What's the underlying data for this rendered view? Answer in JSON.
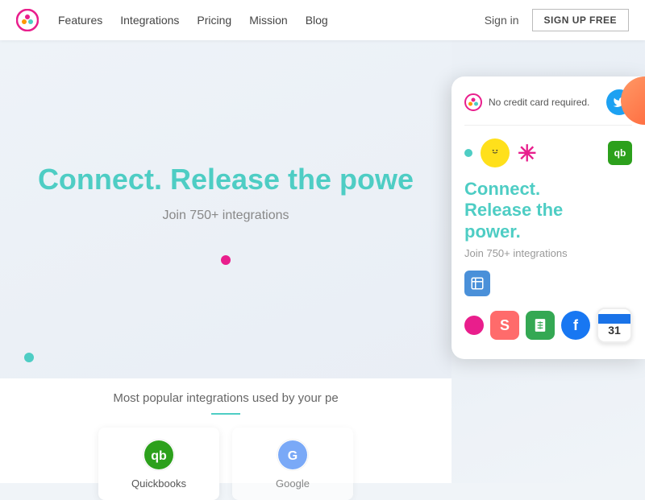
{
  "nav": {
    "links": [
      "Features",
      "Integrations",
      "Pricing",
      "Mission",
      "Blog"
    ],
    "signin_label": "Sign in",
    "signup_label": "SIGN UP FREE"
  },
  "hero": {
    "title": "Connect. Release the powe",
    "subtitle": "Join 750+ integrations",
    "integrations_heading": "Most popular integrations used by your pe"
  },
  "phone": {
    "no_cc": "No credit card required.",
    "title_line1": "Connect.",
    "title_line2": "Release the",
    "title_line3": "power.",
    "subtitle": "Join 750+ integrations"
  },
  "integration_cards": [
    {
      "label": "Quickbooks",
      "color": "#2ca01c"
    },
    {
      "label": "Google",
      "color": "#4285f4"
    }
  ]
}
